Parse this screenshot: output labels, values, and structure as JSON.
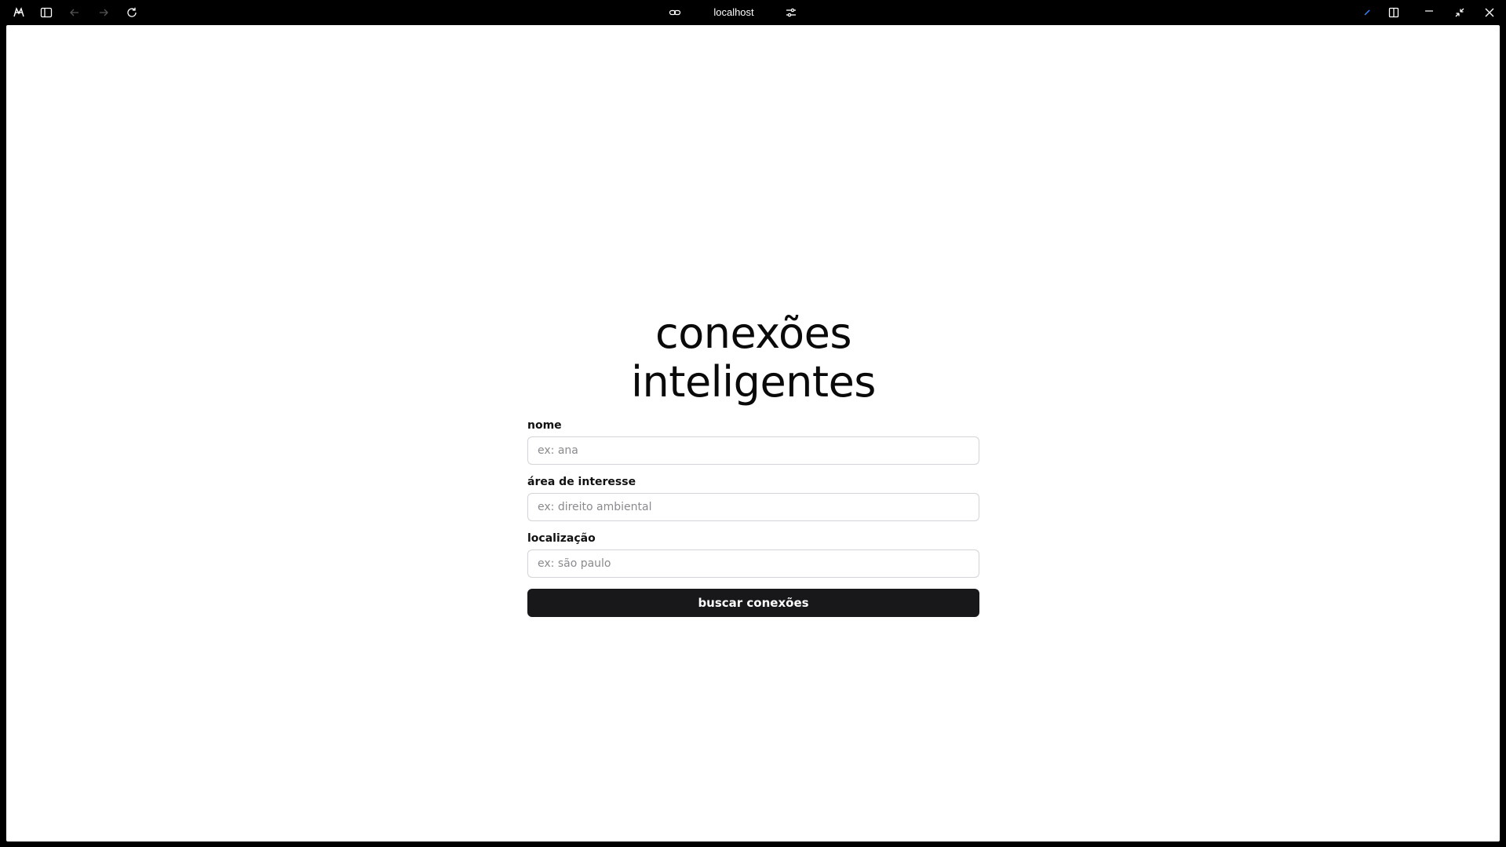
{
  "browser": {
    "url": "localhost",
    "icons": {
      "app": "brand-logo-icon",
      "sidebar": "sidebar-toggle-icon",
      "back": "arrow-left-icon",
      "forward": "arrow-right-icon",
      "reload": "reload-icon",
      "link": "link-icon",
      "settings": "sliders-icon",
      "split": "split-view-icon",
      "minimize": "minimize-icon",
      "restore": "restore-icon",
      "close": "close-icon"
    }
  },
  "page": {
    "title": "conexões inteligentes",
    "fields": [
      {
        "label": "nome",
        "placeholder": "ex: ana",
        "value": ""
      },
      {
        "label": "área de interesse",
        "placeholder": "ex: direito ambiental",
        "value": ""
      },
      {
        "label": "localização",
        "placeholder": "ex: são paulo",
        "value": ""
      }
    ],
    "submit_label": "buscar conexões"
  },
  "colors": {
    "chrome_bg": "#000000",
    "page_bg": "#ffffff",
    "button_bg": "#18181b",
    "button_text": "#ffffff",
    "input_border": "#d4d4d8"
  }
}
